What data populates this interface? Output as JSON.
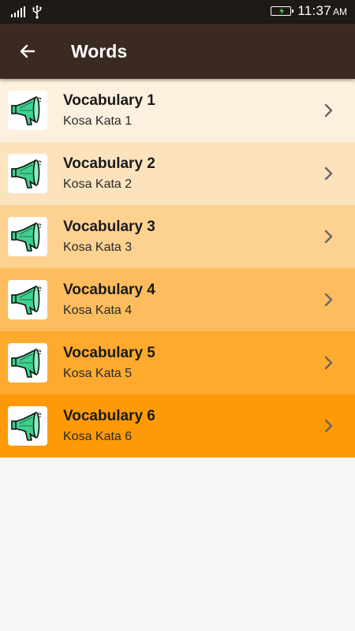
{
  "status_bar": {
    "time": "11:37",
    "ampm": "AM",
    "icons": [
      "signal-icon",
      "usb-icon",
      "battery-charging-icon"
    ]
  },
  "app_bar": {
    "title": "Words",
    "back_icon": "arrow-left-icon"
  },
  "colors": {
    "status_bar": "#1e1a17",
    "app_bar": "#3b2a22",
    "background": "#f7f7f7",
    "row_1": "#fdf0de",
    "row_2": "#fde3bd",
    "row_3": "#fdd190",
    "row_4": "#fdbd5e",
    "row_5": "#fdaa2e",
    "row_6": "#fe9a07"
  },
  "list": {
    "items": [
      {
        "title": "Vocabulary 1",
        "subtitle": "Kosa Kata 1",
        "icon": "megaphone-icon"
      },
      {
        "title": "Vocabulary 2",
        "subtitle": "Kosa Kata 2",
        "icon": "megaphone-icon"
      },
      {
        "title": "Vocabulary 3",
        "subtitle": "Kosa Kata 3",
        "icon": "megaphone-icon"
      },
      {
        "title": "Vocabulary 4",
        "subtitle": "Kosa Kata 4",
        "icon": "megaphone-icon"
      },
      {
        "title": "Vocabulary 5",
        "subtitle": "Kosa Kata 5",
        "icon": "megaphone-icon"
      },
      {
        "title": "Vocabulary 6",
        "subtitle": "Kosa Kata 6",
        "icon": "megaphone-icon"
      }
    ]
  }
}
